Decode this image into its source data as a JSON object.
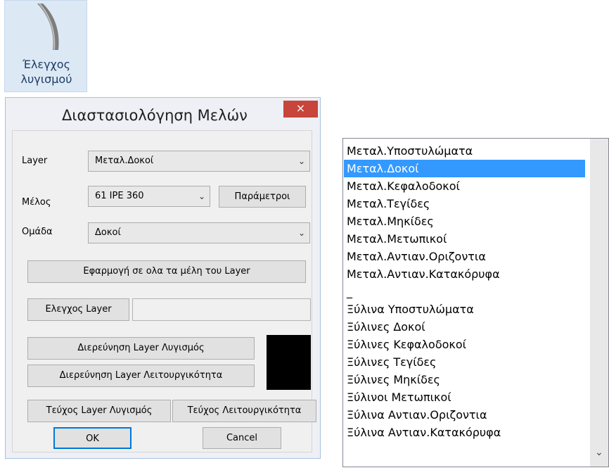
{
  "ribbon": {
    "label_line1": "Έλεγχος",
    "label_line2": "λυγισμού",
    "icon": "buckling-beam-icon"
  },
  "dialog": {
    "title": "Διαστασιολόγηση Μελών",
    "close_glyph": "×",
    "layer_label": "Layer",
    "layer_value": "Μεταλ.Δοκοί",
    "member_label": "Μέλος",
    "member_value": "61 IPE 360",
    "params_button": "Παράμετροι",
    "group_label": "Ομάδα",
    "group_value": "Δοκοί",
    "apply_all_button": "Εφαρμογή σε ολα τα μέλη του Layer",
    "check_layer_button": "Ελεγχος Layer",
    "check_layer_input": "",
    "investigate_buckling_button": "Διερεύνηση Layer Λυγισμός",
    "investigate_function_button": "Διερεύνηση Layer Λειτουργικότητα",
    "booklet_buckling_button": "Τεύχος Layer Λυγισμός",
    "booklet_function_button": "Τεύχος Λειτουργικότητα",
    "ok_button": "OK",
    "cancel_button": "Cancel",
    "color_swatch": "#000000"
  },
  "layer_list": {
    "selected_index": 1,
    "items": [
      "Μεταλ.Υποστυλώματα",
      "Μεταλ.Δοκοί",
      "Μεταλ.Κεφαλοδοκοί",
      "Μεταλ.Τεγίδες",
      "Μεταλ.Μηκίδες",
      "Μεταλ.Μετωπικοί",
      "Μεταλ.Αντιαν.Οριζοντια",
      "Μεταλ.Αντιαν.Κατακόρυφα",
      "_",
      "Ξύλινα Υποστυλώματα",
      "Ξύλινες Δοκοί",
      "Ξύλινες Κεφαλοδοκοί",
      "Ξύλινες Τεγίδες",
      "Ξύλινες Μηκίδες",
      "Ξύλινοι Μετωπικοί",
      "Ξύλινα Αντιαν.Οριζοντια",
      "Ξύλινα Αντιαν.Κατακόρυφα"
    ]
  },
  "colors": {
    "selection": "#3399ff",
    "close_button": "#c7453a",
    "ribbon_bg": "#dce9f5"
  }
}
